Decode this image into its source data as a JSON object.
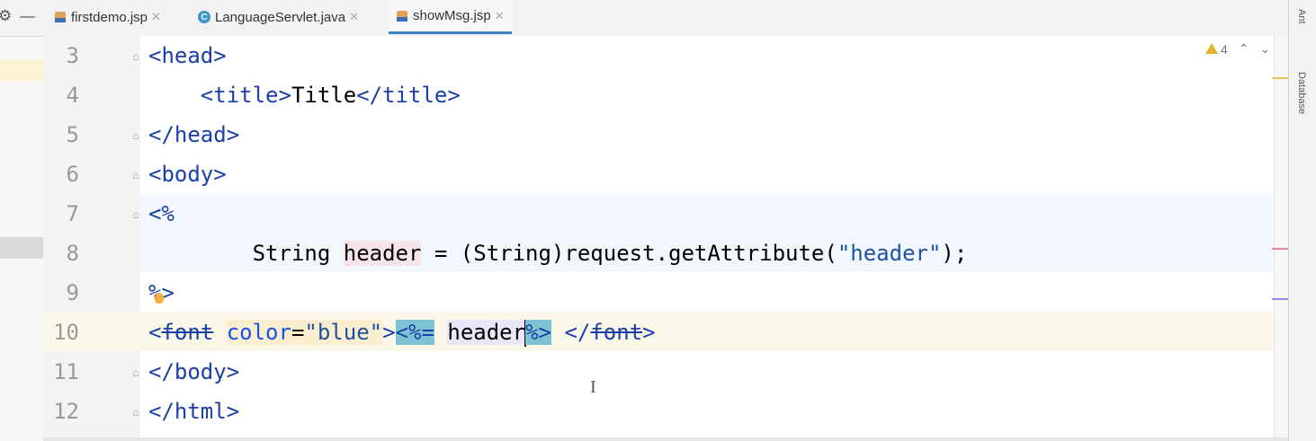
{
  "tabs": [
    {
      "label": "firstdemo.jsp",
      "icon": "jsp-file-icon",
      "active": false
    },
    {
      "label": "LanguageServlet.java",
      "icon": "java-class-icon",
      "active": false
    },
    {
      "label": "showMsg.jsp",
      "icon": "jsp-file-icon",
      "active": true
    }
  ],
  "toolbar": {
    "settings_glyph": "⚙",
    "minimize_glyph": "—"
  },
  "inspection": {
    "warning_count": "4"
  },
  "side_tools": {
    "ant": "Ant",
    "database": "Database"
  },
  "editor": {
    "lines": [
      {
        "number": "3",
        "text": "<head>"
      },
      {
        "number": "4",
        "text": "    <title>Title</title>"
      },
      {
        "number": "5",
        "text": "</head>"
      },
      {
        "number": "6",
        "text": "<body>"
      },
      {
        "number": "7",
        "text": "<%"
      },
      {
        "number": "8",
        "text": "        String header = (String)request.getAttribute(\"header\");"
      },
      {
        "number": "9",
        "text": "%>"
      },
      {
        "number": "10",
        "text": "<font color=\"blue\"><%= header%> </font>"
      },
      {
        "number": "11",
        "text": "</body>"
      },
      {
        "number": "12",
        "text": "</html>"
      }
    ]
  },
  "colors": {
    "tag": "#1a3fa5",
    "string": "#067d17",
    "scriptlet_highlight": "#7cc4d4",
    "active_tab_underline": "#4083c9",
    "current_line": "#fcf8e9"
  }
}
